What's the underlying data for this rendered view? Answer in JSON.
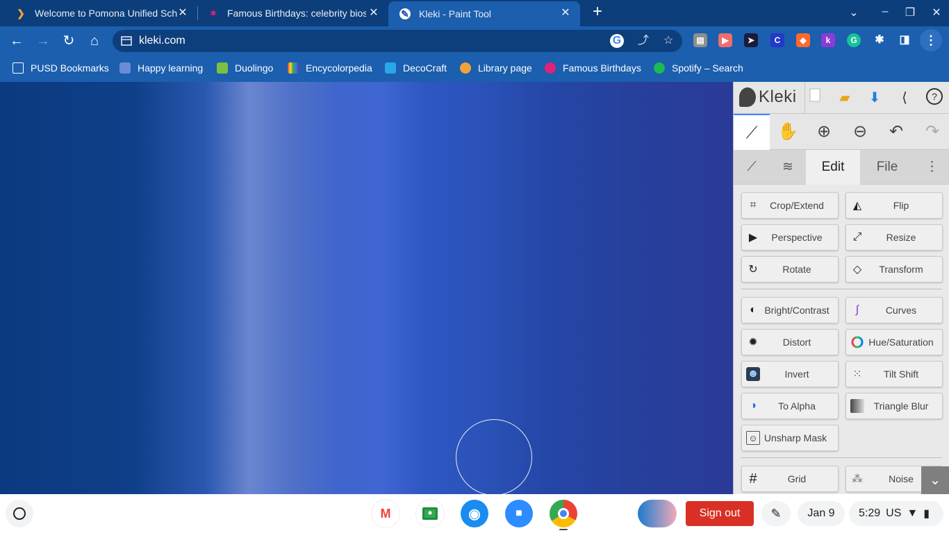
{
  "browser": {
    "tabs": [
      {
        "title": "Welcome to Pomona Unified Sch",
        "active": false
      },
      {
        "title": "Famous Birthdays: celebrity bios",
        "active": false
      },
      {
        "title": "Kleki - Paint Tool",
        "active": true
      }
    ],
    "url": "kleki.com",
    "bookmarks": [
      {
        "label": "PUSD Bookmarks",
        "icon": "folder-icon"
      },
      {
        "label": "Happy learning",
        "icon": "happy-learning-icon"
      },
      {
        "label": "Duolingo",
        "icon": "duolingo-icon"
      },
      {
        "label": "Encycolorpedia",
        "icon": "encycolorpedia-icon"
      },
      {
        "label": "DecoCraft",
        "icon": "decocraft-icon"
      },
      {
        "label": "Library page",
        "icon": "library-icon"
      },
      {
        "label": "Famous Birthdays",
        "icon": "famous-birthdays-icon"
      },
      {
        "label": "Spotify – Search",
        "icon": "spotify-icon"
      }
    ]
  },
  "kleki": {
    "logo": "Kleki",
    "tabs": {
      "edit": "Edit",
      "file": "File",
      "active": "Edit"
    },
    "filters": [
      {
        "label": "Crop/Extend",
        "icon": "crop-icon"
      },
      {
        "label": "Flip",
        "icon": "flip-icon"
      },
      {
        "label": "Perspective",
        "icon": "perspective-icon"
      },
      {
        "label": "Resize",
        "icon": "resize-icon"
      },
      {
        "label": "Rotate",
        "icon": "rotate-icon"
      },
      {
        "label": "Transform",
        "icon": "transform-icon"
      },
      {
        "label": "Bright/Contrast",
        "icon": "brightness-icon"
      },
      {
        "label": "Curves",
        "icon": "curves-icon"
      },
      {
        "label": "Distort",
        "icon": "distort-icon"
      },
      {
        "label": "Hue/Saturation",
        "icon": "hue-icon"
      },
      {
        "label": "Invert",
        "icon": "invert-icon"
      },
      {
        "label": "Tilt Shift",
        "icon": "tilt-shift-icon"
      },
      {
        "label": "To Alpha",
        "icon": "to-alpha-icon"
      },
      {
        "label": "Triangle Blur",
        "icon": "triangle-blur-icon"
      },
      {
        "label": "Unsharp Mask",
        "icon": "unsharp-mask-icon"
      },
      {
        "label": "Grid",
        "icon": "grid-icon"
      },
      {
        "label": "Noise",
        "icon": "noise-icon"
      }
    ]
  },
  "shelf": {
    "sign_out": "Sign out",
    "date": "Jan 9",
    "time": "5:29",
    "locale": "US"
  },
  "colors": {
    "chrome_bg": "#0b3e7a",
    "toolbar_bg": "#1b5fae",
    "sign_out": "#d93025",
    "kleki_accent": "#4a84ff"
  }
}
